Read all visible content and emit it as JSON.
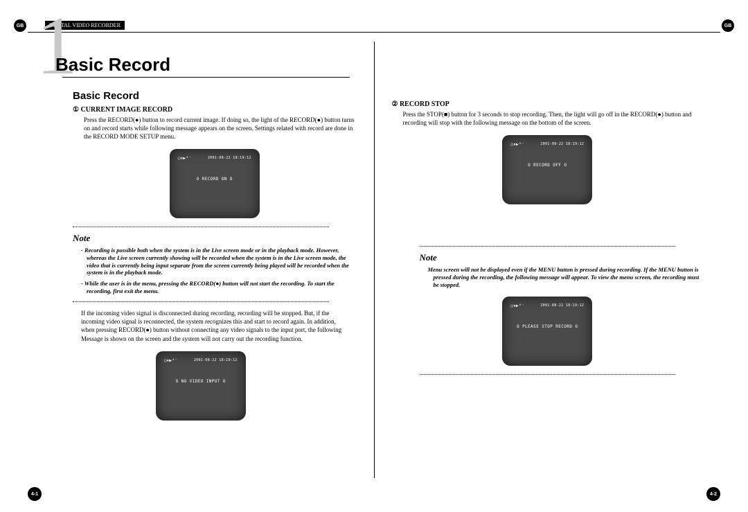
{
  "badge": "GB",
  "header_label": "DIGITAL VIDEO RECORDER",
  "chapter_number": "1",
  "chapter_title": "Basic Record",
  "section_title": "Basic Record",
  "left": {
    "sub_head": "① CURRENT IMAGE RECORD",
    "body": "Press the RECORD(●) button to record current image. If doing so, the light of the RECORD(●) button turns on and record starts while following message appears on the screen. Settings related with record are done in the RECORD MODE SETUP menu.",
    "monitor1": {
      "icons": "◯⏸▶⁴⁻",
      "timestamp": "2001-08-22 18:19:12",
      "message": "O RECORD ON O"
    },
    "note_title": "Note",
    "note_items": [
      "- Recording is possible both when the system is in the Live screen mode or in the playback mode. However, whereas the Live screen currently showing will be recorded when the system is in the Live screen mode, the video that is currently being input separate from the screen currently being played will be recorded when the system is in the playback mode.",
      "- While the user is in the menu, pressing the RECORD(●) button will not start the recording. To start the recording, first exit the menu."
    ],
    "plain_para": "If the incoming video signal is disconnected during recording, recording will be stopped. But, if the incoming video signal is reconnected, the system recognizes this and start to record again. In addition, when pressing RECORD(●) button without connecting any video signals to the input port, the following Message is shown on the screen and the system will not carry out the recording function.",
    "monitor2": {
      "icons": "◯⏸▶⁴⁻",
      "timestamp": "2001-08-22 18:19:12",
      "message": "O NO VIDEO INPUT O"
    }
  },
  "right": {
    "sub_head": "② RECORD STOP",
    "body": "Press the STOP(■) button for 3 seconds to stop recording. Then, the light will go off in the RECORD(●) button and recording will stop with the following message on the bottom of the screen.",
    "monitor1": {
      "icons": "◯⏸▶⁴⁻",
      "timestamp": "2001-08-22 18:19:12",
      "message": "O RECORD OFF O"
    },
    "note_title": "Note",
    "note_items": [
      "Menu screen will not be displayed even if the MENU button is pressed during recording. If the MENU button is pressed during the recording, the following message will appear. To view the menu screen, the recording must be stopped."
    ],
    "monitor2": {
      "icons": "◯⏸▶⁴⁻",
      "timestamp": "2001-08-22 18:19:12",
      "message": "O PLEASE STOP RECORD O"
    }
  },
  "page_left": "4-1",
  "page_right": "4-2"
}
